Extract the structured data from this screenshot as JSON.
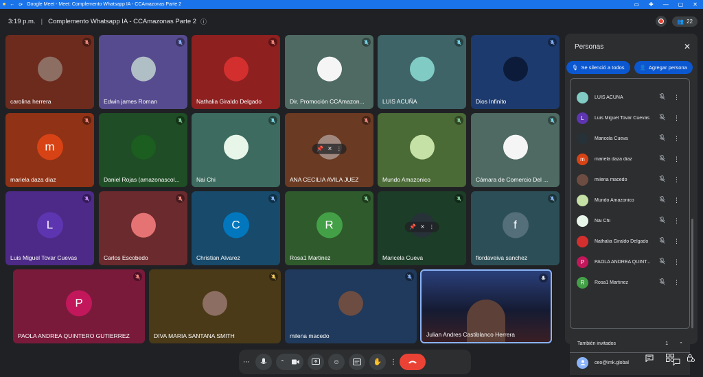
{
  "browser": {
    "title": "Google Meet - Meet: Complemento Whatsapp IA - CCAmazonas Parte 2"
  },
  "meeting": {
    "time": "3:19 p.m.",
    "title": "Complemento Whatsapp IA - CCAmazonas Parte 2",
    "participant_count": "22"
  },
  "tiles": [
    {
      "name": "carolina herrera",
      "bg": "#6d2b1e",
      "avatar_type": "photo",
      "avatar_color": "#8d6e63",
      "mic": "muted"
    },
    {
      "name": "Edwin james Roman",
      "bg": "#574b8f",
      "avatar_type": "photo",
      "avatar_color": "#b0bec5",
      "mic": "muted-blue"
    },
    {
      "name": "Nathalia Giraldo Delgado",
      "bg": "#8e2020",
      "avatar_type": "photo",
      "avatar_color": "#d32f2f",
      "mic": "muted"
    },
    {
      "name": "Dir. Promoción CCAmazon...",
      "bg": "#4e6a63",
      "avatar_type": "photo",
      "avatar_color": "#f5f5f5",
      "mic": "muted-teal"
    },
    {
      "name": "LUIS ACUÑA",
      "bg": "#3e6468",
      "avatar_type": "photo",
      "avatar_color": "#80cbc4",
      "mic": "muted-teal"
    },
    {
      "name": "Dios Infinito",
      "bg": "#1c3a6d",
      "avatar_type": "photo",
      "avatar_color": "#0d1b3a",
      "mic": "muted-blue"
    },
    {
      "name": "mariela daza diaz",
      "bg": "#8f3216",
      "avatar_type": "letter",
      "letter": "m",
      "avatar_color": "#d84315",
      "mic": "muted"
    },
    {
      "name": "Daniel Rojas (amazonascol...",
      "bg": "#1f4d25",
      "avatar_type": "photo",
      "avatar_color": "#1b5e20",
      "mic": "muted-green"
    },
    {
      "name": "Nai Chi",
      "bg": "#3d6b5f",
      "avatar_type": "photo",
      "avatar_color": "#e8f5e9",
      "mic": "muted-teal"
    },
    {
      "name": "ANA CECILIA AVILA JUEZ",
      "bg": "#6b3a22",
      "avatar_type": "photo",
      "avatar_color": "#a1887f",
      "mic": "muted"
    },
    {
      "name": "Mundo Amazonico",
      "bg": "#4a6a36",
      "avatar_type": "photo",
      "avatar_color": "#c5e1a5",
      "mic": "muted-green"
    },
    {
      "name": "Cámara de Comercio Del ...",
      "bg": "#4e6a63",
      "avatar_type": "photo",
      "avatar_color": "#f5f5f5",
      "mic": "muted-teal"
    },
    {
      "name": "Luis Miguel Tovar Cuevas",
      "bg": "#4d2a87",
      "avatar_type": "letter",
      "letter": "L",
      "avatar_color": "#5e35b1",
      "mic": "muted-purple"
    },
    {
      "name": "Carlos Escobedo",
      "bg": "#6b2a2e",
      "avatar_type": "photo",
      "avatar_color": "#e57373",
      "mic": "muted"
    },
    {
      "name": "Christian Alvarez",
      "bg": "#174a6b",
      "avatar_type": "letter",
      "letter": "C",
      "avatar_color": "#0277bd",
      "mic": "muted-blue"
    },
    {
      "name": "Rosa1 Martinez",
      "bg": "#2e5a2c",
      "avatar_type": "letter",
      "letter": "R",
      "avatar_color": "#43a047",
      "mic": "muted-green"
    },
    {
      "name": "Maricela Cueva",
      "bg": "#1c3d27",
      "avatar_type": "photo",
      "avatar_color": "#263238",
      "mic": "muted-green"
    },
    {
      "name": "flordaveiva sanchez",
      "bg": "#2c4f57",
      "avatar_type": "letter",
      "letter": "f",
      "avatar_color": "#546e7a",
      "mic": "muted-blue"
    },
    {
      "name": "PAOLA ANDREA QUINTERO GUTIERREZ",
      "bg": "#7a1a3b",
      "avatar_type": "letter",
      "letter": "P",
      "avatar_color": "#c2185b",
      "mic": "muted"
    },
    {
      "name": "DIVA MARIA SANTANA SMITH",
      "bg": "#4a3a18",
      "avatar_type": "photo",
      "avatar_color": "#8d6e63",
      "mic": "muted-yellow"
    },
    {
      "name": "milena macedo",
      "bg": "#1f3a5c",
      "avatar_type": "photo",
      "avatar_color": "#6d4c41",
      "mic": "muted-blue"
    },
    {
      "name": "Julian Andres Castiblanco Herrera",
      "bg": "#172138",
      "avatar_type": "video",
      "avatar_color": "#c62828",
      "mic": "on"
    }
  ],
  "panel": {
    "title": "Personas",
    "chip_muted": "Se silenció a todos",
    "chip_add": "Agregar persona",
    "people": [
      {
        "name": "LUIS ACUÑA",
        "color": "#80cbc4",
        "letter": ""
      },
      {
        "name": "Luis Miguel Tovar Cuevas",
        "color": "#5e35b1",
        "letter": "L"
      },
      {
        "name": "Maricela Cueva",
        "color": "#263238",
        "letter": ""
      },
      {
        "name": "mariela daza diaz",
        "color": "#d84315",
        "letter": "m"
      },
      {
        "name": "milena macedo",
        "color": "#6d4c41",
        "letter": ""
      },
      {
        "name": "Mundo Amazonico",
        "color": "#c5e1a5",
        "letter": ""
      },
      {
        "name": "Nai Chi",
        "color": "#e8f5e9",
        "letter": ""
      },
      {
        "name": "Nathalia Giraldo Delgado",
        "color": "#d32f2f",
        "letter": ""
      },
      {
        "name": "PAOLA ANDREA QUINT...",
        "color": "#c2185b",
        "letter": "P"
      },
      {
        "name": "Rosa1 Martinez",
        "color": "#43a047",
        "letter": "R"
      }
    ],
    "guests_label": "También invitados",
    "guests_count": "1",
    "guest_email": "ceo@imk.global"
  }
}
